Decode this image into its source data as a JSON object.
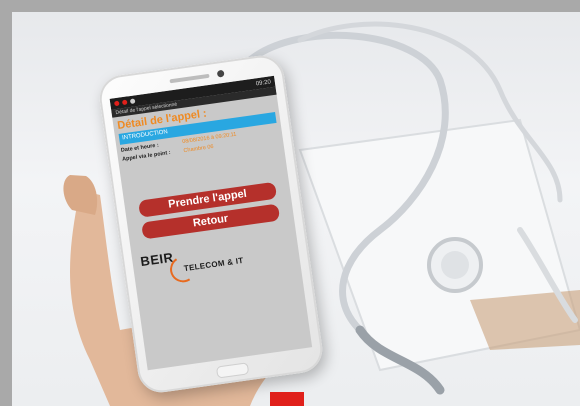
{
  "status_bar": {
    "time": "09:20"
  },
  "app_bar": {
    "title": "Détail de l'appel sélectionné"
  },
  "page": {
    "title": "Détail de l'appel :"
  },
  "section": {
    "label": "INTRODUCTION"
  },
  "details": {
    "datetime_label": "Date et heure :",
    "datetime_value": "08/08/2016 à 09:20:11",
    "point_label": "Appel via le point :",
    "point_value": "Chambre 06"
  },
  "actions": {
    "take_call_label": "Prendre l'appel",
    "back_label": "Retour"
  },
  "logo": {
    "brand": "BEIR",
    "tagline": "TELECOM & IT"
  },
  "colors": {
    "title_orange": "#ef8a22",
    "section_blue": "#29a7e1",
    "button_red": "#b5302b",
    "corner_red": "#e0201b"
  }
}
